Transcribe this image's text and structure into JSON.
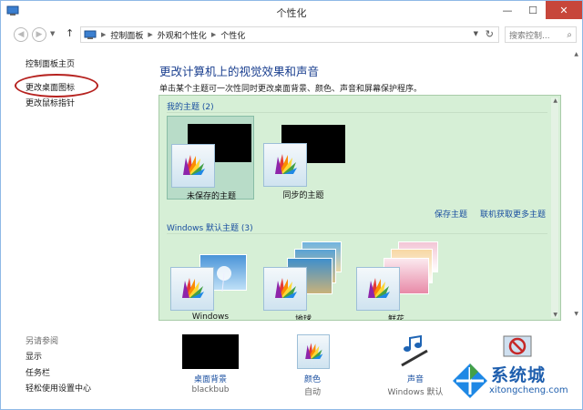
{
  "window": {
    "title": "个性化"
  },
  "address": {
    "crumbs": [
      "控制面板",
      "外观和个性化",
      "个性化"
    ],
    "search_placeholder": "搜索控制..."
  },
  "left_pane": {
    "links": [
      "控制面板主页",
      "更改桌面图标",
      "更改鼠标指针"
    ],
    "see_also_title": "另请参阅",
    "see_also": [
      "显示",
      "任务栏",
      "轻松使用设置中心"
    ]
  },
  "main": {
    "title": "更改计算机上的视觉效果和声音",
    "description": "单击某个主题可一次性同时更改桌面背景、颜色、声音和屏幕保护程序。",
    "my_themes": {
      "title": "我的主题 (2)",
      "items": [
        "未保存的主题",
        "同步的主题"
      ],
      "links": [
        "保存主题",
        "联机获取更多主题"
      ]
    },
    "default_themes": {
      "title": "Windows 默认主题 (3)",
      "items": [
        "Windows",
        "地球",
        "鲜花"
      ]
    }
  },
  "bottom": {
    "items": [
      {
        "label": "桌面背景",
        "sub": "blackbub"
      },
      {
        "label": "颜色",
        "sub": "自动"
      },
      {
        "label": "声音",
        "sub": "Windows 默认"
      },
      {
        "label": "",
        "sub": ""
      }
    ]
  },
  "watermark": {
    "text": "系统城",
    "sub": "xitongcheng.com"
  },
  "colors": {
    "accent": "#1a4fa0",
    "panel": "#d6efd6",
    "close": "#c7463b",
    "circle": "#b6221f"
  }
}
